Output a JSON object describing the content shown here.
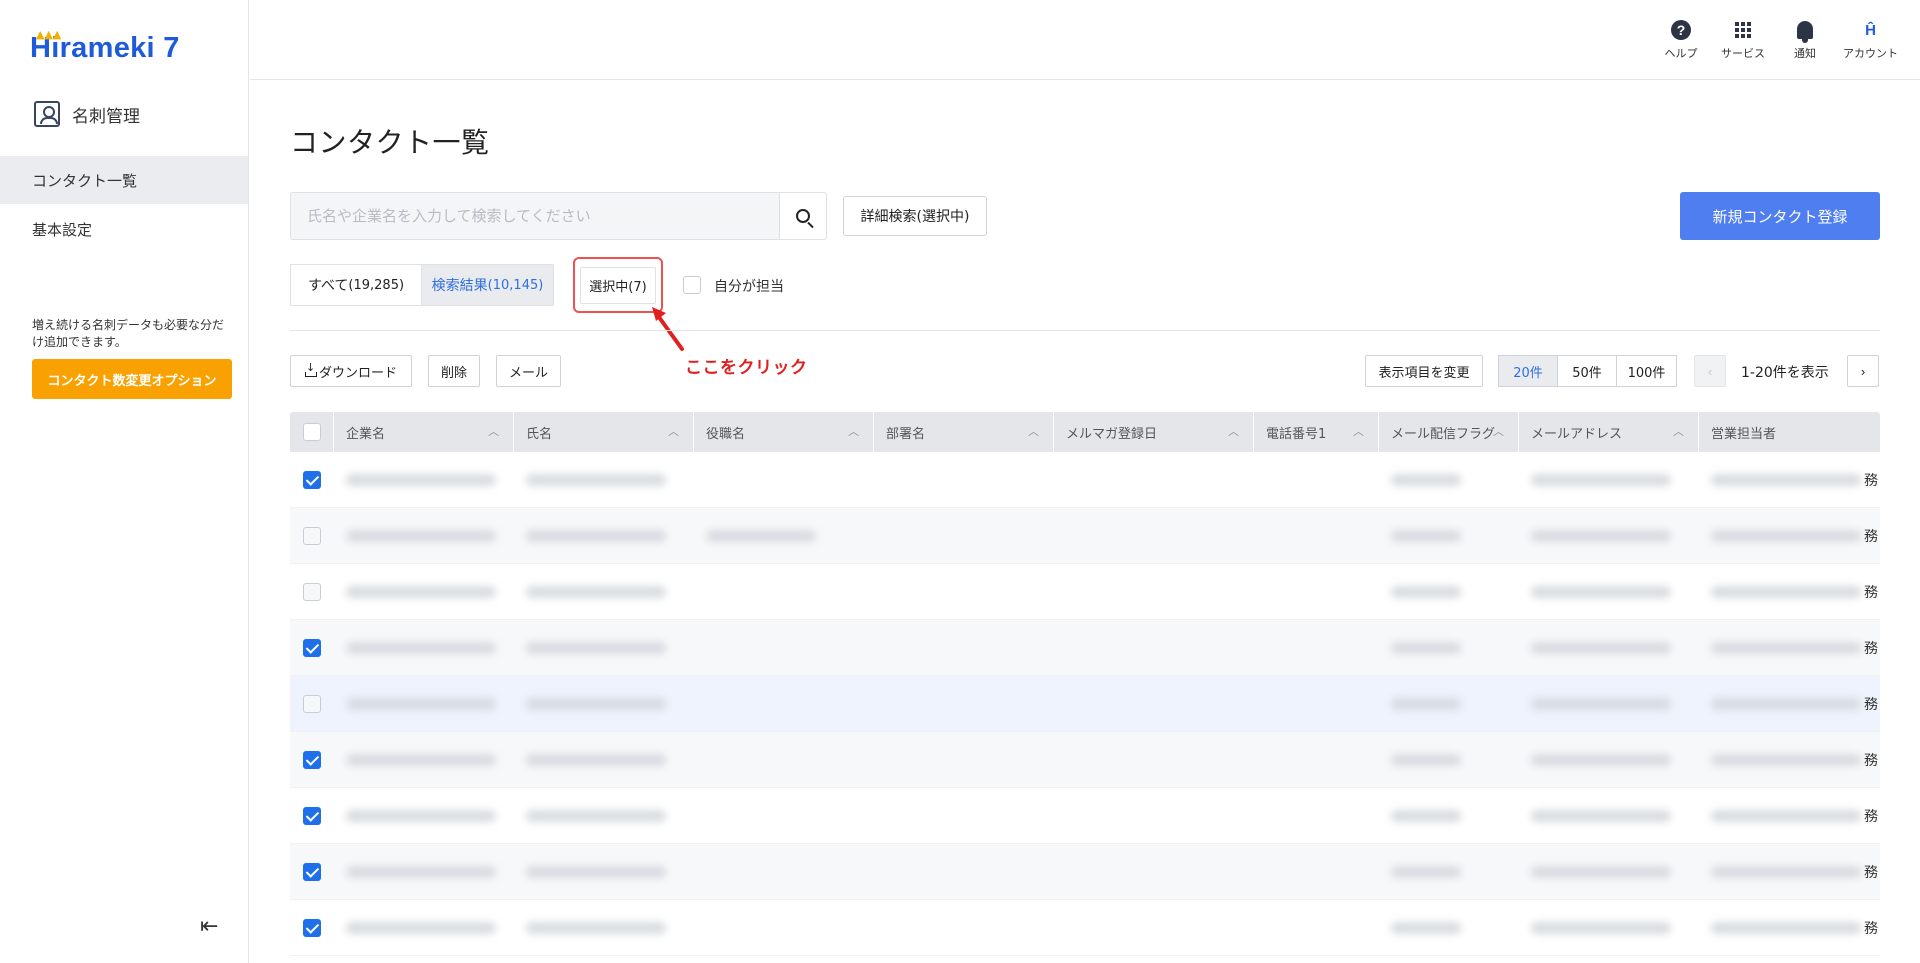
{
  "app": {
    "logo": "Hirameki 7",
    "module": "名刺管理"
  },
  "sidebar": {
    "items": [
      {
        "label": "コンタクト一覧",
        "active": true
      },
      {
        "label": "基本設定",
        "active": false
      }
    ],
    "promo_text": "増え続ける名刺データも必要な分だけ追加できます。",
    "promo_button": "コンタクト数変更オプション",
    "collapse_icon": "collapse-left-icon"
  },
  "topbar": {
    "help": "ヘルプ",
    "services": "サービス",
    "notifications": "通知",
    "account": "アカウント"
  },
  "main": {
    "title": "コンタクト一覧",
    "search_placeholder": "氏名や企業名を入力して検索してください",
    "advanced_search": "詳細検索(選択中)",
    "new_contact": "新規コンタクト登録",
    "filters": {
      "all_label": "すべて",
      "all_count": "(19,285)",
      "results_label": "検索結果",
      "results_count": "(10,145)",
      "selected": "選択中(7)",
      "self_assigned": "自分が担当"
    },
    "annotation": "ここをクリック",
    "actions": {
      "download": "ダウンロード",
      "delete": "削除",
      "mail": "メール"
    },
    "column_settings": "表示項目を変更",
    "per_page": [
      "20件",
      "50件",
      "100件"
    ],
    "per_page_selected": "20件",
    "pagination": {
      "prev": "‹",
      "range": "1-20件を表示",
      "next": "›"
    }
  },
  "table": {
    "columns": [
      "企業名",
      "氏名",
      "役職名",
      "部署名",
      "メルマガ登録日",
      "電話番号1",
      "メール配信フラグ",
      "メールアドレス",
      "営業担当者"
    ],
    "rows": [
      {
        "checked": true,
        "trailing": "務"
      },
      {
        "checked": false,
        "trailing": "務"
      },
      {
        "checked": false,
        "trailing": "務"
      },
      {
        "checked": true,
        "trailing": "務"
      },
      {
        "checked": false,
        "trailing": "務"
      },
      {
        "checked": true,
        "trailing": "務"
      },
      {
        "checked": true,
        "trailing": "務"
      },
      {
        "checked": true,
        "trailing": "務"
      },
      {
        "checked": true,
        "trailing": "務"
      }
    ]
  },
  "colors": {
    "accent": "#4f7ef0",
    "link": "#2f6fe0",
    "promo": "#f9a100",
    "annotation": "#e02020",
    "check": "#1f6fe8"
  }
}
